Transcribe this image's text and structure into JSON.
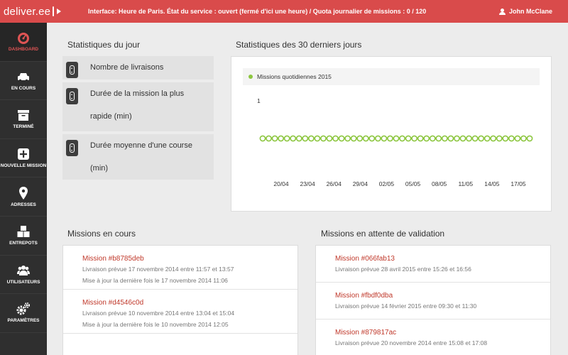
{
  "app": {
    "logo": "deliver.ee",
    "status": "Interface: Heure de Paris. État du service : ouvert (fermé d'ici une heure) / Quota journalier de missions : 0 / 120",
    "user": "John McClane"
  },
  "nav": [
    {
      "label": "DASHBOARD",
      "icon": "gauge-icon"
    },
    {
      "label": "EN COURS",
      "icon": "car-icon"
    },
    {
      "label": "TERMINÉ",
      "icon": "archive-box-icon"
    },
    {
      "label": "NOUVELLE MISSION",
      "icon": "plus-square-icon"
    },
    {
      "label": "ADRESSES",
      "icon": "map-marker-icon"
    },
    {
      "label": "ENTREPOTS",
      "icon": "boxes-icon"
    },
    {
      "label": "UTILISATEURS",
      "icon": "users-icon"
    },
    {
      "label": "PARAMÈTRES",
      "icon": "gears-icon"
    }
  ],
  "stats_today": {
    "title": "Statistiques du jour",
    "items": [
      {
        "label": "Nombre de livraisons"
      },
      {
        "label": "Durée de la mission la plus rapide (min)"
      },
      {
        "label": "Durée moyenne d'une course (min)"
      }
    ]
  },
  "stats_30": {
    "title": "Statistiques des 30 derniers jours",
    "legend": "Missions quotidiennes 2015",
    "y_tick": "1"
  },
  "chart_data": {
    "type": "line",
    "title": "",
    "series": [
      {
        "name": "Missions quotidiennes 2015",
        "values": [
          1,
          1,
          1,
          1,
          1,
          1,
          1,
          1,
          1,
          1,
          1,
          1,
          1,
          1,
          1,
          1,
          1,
          1,
          1,
          1,
          1,
          1,
          1,
          1,
          1,
          1,
          1,
          1,
          1,
          1,
          1,
          1,
          1,
          1,
          1,
          1,
          1,
          1,
          1,
          1,
          1,
          1,
          1,
          1,
          1
        ]
      }
    ],
    "x_tick_labels": [
      "20/04",
      "23/04",
      "26/04",
      "29/04",
      "02/05",
      "05/05",
      "08/05",
      "11/05",
      "14/05",
      "17/05"
    ],
    "y_tick_labels": [
      "1"
    ],
    "color": "#8cc63f",
    "grid": false,
    "legend_position": "top-left"
  },
  "missions_en_cours": {
    "title": "Missions en cours",
    "items": [
      {
        "title": "Mission #b8785deb",
        "line1": "Livraison prévue 17 novembre 2014 entre 11:57 et 13:57",
        "line2": "Mise à jour la dernière fois le 17 novembre 2014 11:06"
      },
      {
        "title": "Mission #d4546c0d",
        "line1": "Livraison prévue 10 novembre 2014 entre 13:04 et 15:04",
        "line2": "Mise à jour la dernière fois le 10 novembre 2014 12:05"
      }
    ]
  },
  "missions_attente": {
    "title": "Missions en attente de validation",
    "items": [
      {
        "title": "Mission #066fab13",
        "line1": "Livraison prévue 28 avril 2015 entre 15:26 et 16:56"
      },
      {
        "title": "Mission #fbdf0dba",
        "line1": "Livraison prévue 14 février 2015 entre 09:30 et 11:30"
      },
      {
        "title": "Mission #879817ac",
        "line1": "Livraison prévue 20 novembre 2014 entre 15:08 et 17:08"
      }
    ]
  }
}
